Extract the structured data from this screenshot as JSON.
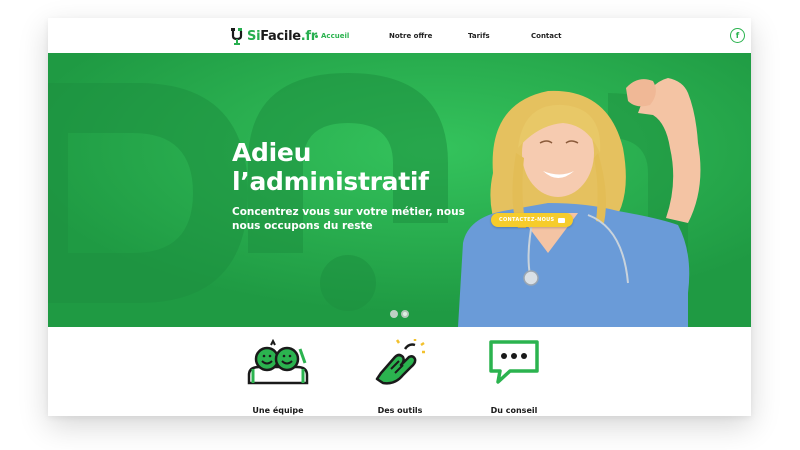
{
  "brand": {
    "name_main": "Si",
    "name_rest": "Facile",
    "tld": ".fr",
    "accent": "#2bb34f"
  },
  "nav": {
    "items": [
      {
        "label": "Accueil",
        "active": true
      },
      {
        "label": "Notre offre",
        "active": false
      },
      {
        "label": "Tarifs",
        "active": false
      },
      {
        "label": "Contact",
        "active": false
      }
    ],
    "social_icon": "facebook-icon",
    "social_label": "f"
  },
  "hero": {
    "title_line1": "Adieu",
    "title_line2": "l’administratif",
    "subtitle": "Concentrez vous sur votre métier, nous nous occupons du reste",
    "cta_label": "CONTACTEZ-NOUS",
    "slides": 2,
    "active_slide": 2,
    "background_color": "#25a84b"
  },
  "features": [
    {
      "label": "Une équipe",
      "icon": "team-icon"
    },
    {
      "label": "Des outils",
      "icon": "tools-hand-icon"
    },
    {
      "label": "Du conseil",
      "icon": "chat-bubble-icon"
    }
  ]
}
